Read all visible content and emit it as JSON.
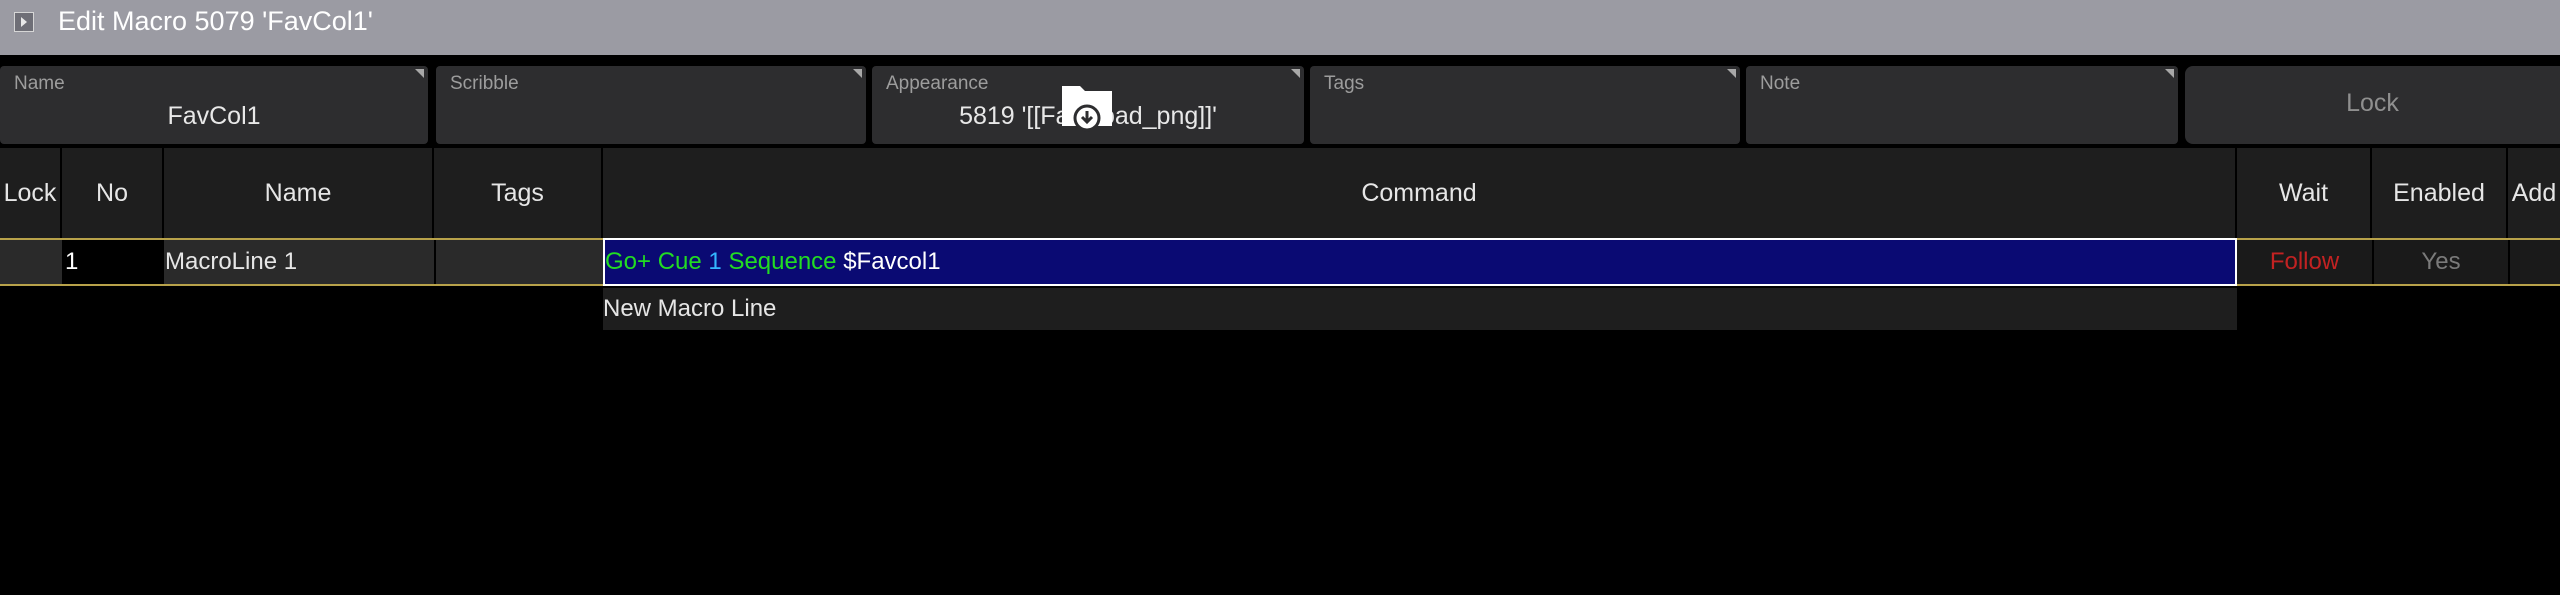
{
  "title": "Edit Macro 5079 'FavCol1'",
  "fields": {
    "name": {
      "label": "Name",
      "value": "FavCol1"
    },
    "scribble": {
      "label": "Scribble",
      "value": ""
    },
    "appearance": {
      "label": "Appearance",
      "value": "5819 '[[Fav...oad_png]]'"
    },
    "tags": {
      "label": "Tags",
      "value": ""
    },
    "note": {
      "label": "Note",
      "value": ""
    },
    "lock_button": "Lock"
  },
  "columns": [
    "Lock",
    "No",
    "Name",
    "Tags",
    "Command",
    "Wait",
    "Enabled",
    "Add"
  ],
  "rows": [
    {
      "lock": "",
      "no": "1",
      "name": "MacroLine 1",
      "tags": "",
      "command": {
        "part1": "Go+ Cue",
        "part2": "1",
        "part3": "Sequence",
        "part4": "$Favcol1"
      },
      "wait": "Follow",
      "enabled": "Yes",
      "add": ""
    }
  ],
  "new_line_label": "New Macro Line",
  "colors": {
    "title_bar": "#9b9ba3",
    "field_bg": "#2d2d2f",
    "header_bg": "#1e1e1e",
    "selected_border": "#b8a24a",
    "command_bg": "#0a0a73",
    "keyword_green": "#22dd22",
    "number_cyan": "#33b7ff",
    "wait_red": "#c22222",
    "enabled_gray": "#7a7a7a"
  },
  "icons": {
    "title": "play-icon",
    "appearance": "folder-download-icon"
  }
}
